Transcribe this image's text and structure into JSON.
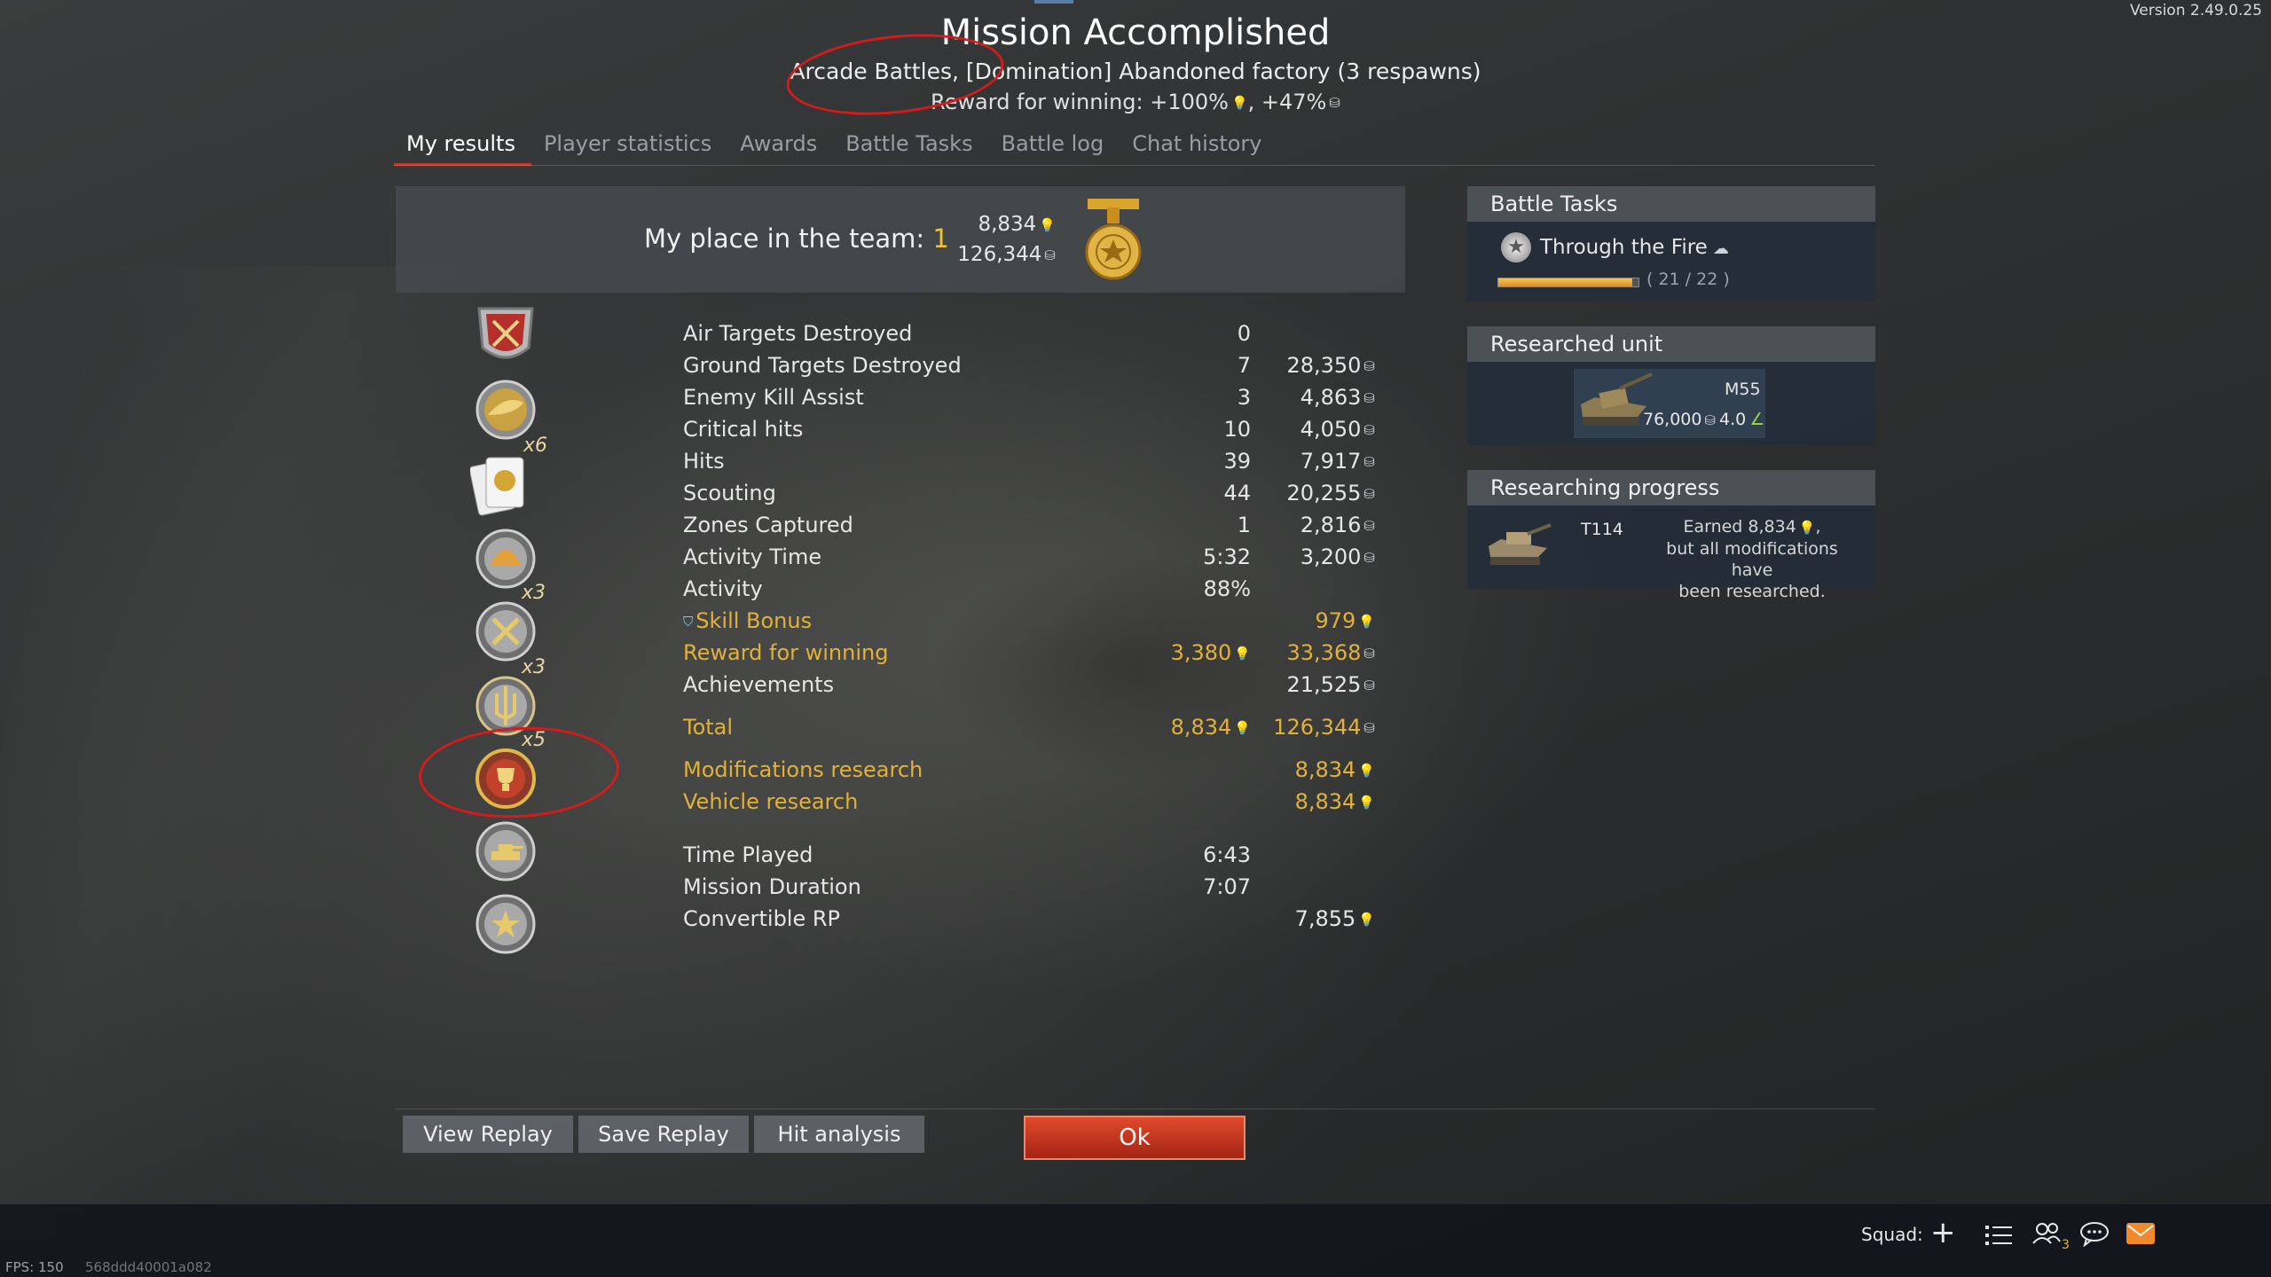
{
  "version": "Version 2.49.0.25",
  "header": {
    "title": "Mission Accomplished",
    "subtitle": "Arcade Battles, [Domination] Abandoned factory (3 respawns)",
    "reward_prefix": "Reward for winning: +100%",
    "reward_sep": ", +47%"
  },
  "tabs": [
    "My results",
    "Player statistics",
    "Awards",
    "Battle Tasks",
    "Battle log",
    "Chat history"
  ],
  "place": {
    "label": "My place in the team: ",
    "value": "1",
    "rp": "8,834",
    "sl": "126,344"
  },
  "award_badges": [
    "x6",
    "x3",
    "x3",
    "x5"
  ],
  "results": [
    {
      "label": "Air Targets Destroyed",
      "v1": "0",
      "v2": ""
    },
    {
      "label": "Ground Targets Destroyed",
      "v1": "7",
      "v2": "28,350"
    },
    {
      "label": "Enemy Kill Assist",
      "v1": "3",
      "v2": "4,863"
    },
    {
      "label": "Critical hits",
      "v1": "10",
      "v2": "4,050"
    },
    {
      "label": "Hits",
      "v1": "39",
      "v2": "7,917"
    },
    {
      "label": "Scouting",
      "v1": "44",
      "v2": "20,255"
    },
    {
      "label": "Zones Captured",
      "v1": "1",
      "v2": "2,816"
    },
    {
      "label": "Activity Time",
      "v1": "5:32",
      "v2": "3,200"
    },
    {
      "label": "Activity",
      "v1": "88%",
      "v2": ""
    },
    {
      "label": "Skill Bonus",
      "v1": "",
      "v2": "979"
    },
    {
      "label": "Reward for winning",
      "v1": "3,380",
      "v2": "33,368"
    },
    {
      "label": "Achievements",
      "v1": "",
      "v2": "21,525"
    },
    {
      "label": "Total",
      "v1": "8,834",
      "v2": "126,344"
    },
    {
      "label": "Modifications research",
      "v1": "",
      "v2": "8,834"
    },
    {
      "label": "Vehicle research",
      "v1": "",
      "v2": "8,834"
    },
    {
      "label": "Time Played",
      "v1": "6:43",
      "v2": ""
    },
    {
      "label": "Mission Duration",
      "v1": "7:07",
      "v2": ""
    },
    {
      "label": "Convertible RP",
      "v1": "",
      "v2": "7,855"
    }
  ],
  "battle_tasks": {
    "header": "Battle Tasks",
    "task_name": "Through the Fire",
    "progress_text": "( 21 / 22 )",
    "progress_fraction": 0.9545
  },
  "researched_unit": {
    "header": "Researched unit",
    "name": "M55",
    "cost": "76,000",
    "br": "4.0"
  },
  "researching_progress": {
    "header": "Researching progress",
    "vehicle": "T114",
    "line1": "Earned 8,834",
    "line2": "but all modifications have",
    "line3": "been researched."
  },
  "buttons": {
    "view_replay": "View Replay",
    "save_replay": "Save Replay",
    "hit_analysis": "Hit analysis",
    "ok": "Ok"
  },
  "footer": {
    "squad": "Squad:",
    "fps": "FPS: 150",
    "hash": "568ddd40001a082",
    "notification_count": "3"
  },
  "colors": {
    "accent_gold": "#e2b13a",
    "rp_blue": "#7fc9ef",
    "ok_red": "#c0331d",
    "annotation_red": "#d21c1c"
  }
}
